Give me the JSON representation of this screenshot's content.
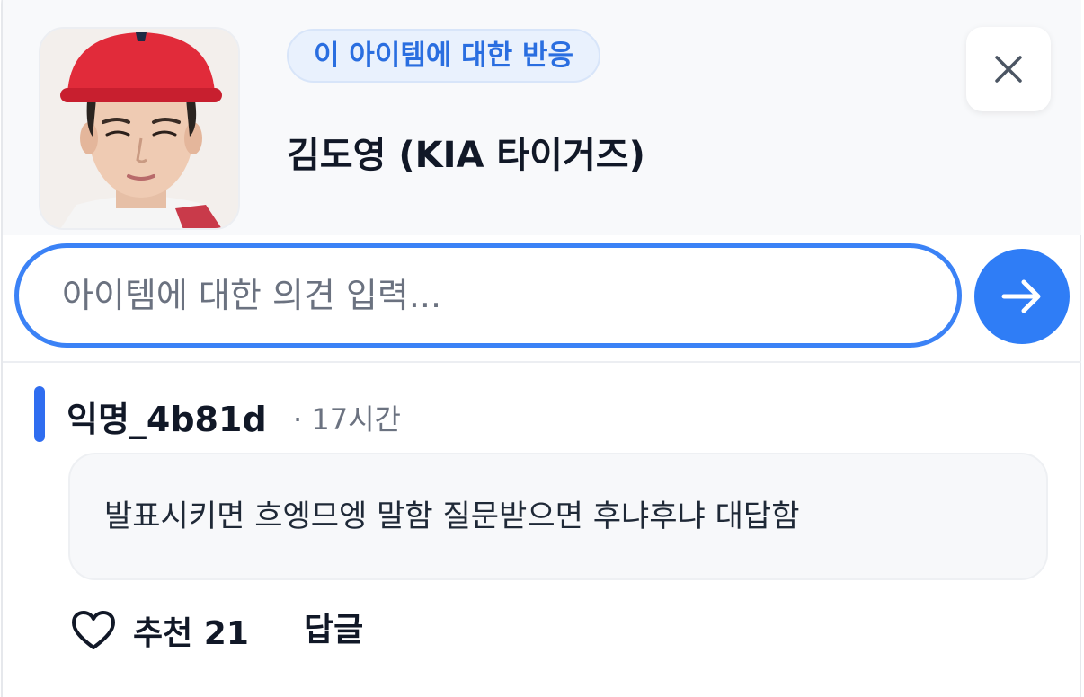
{
  "header": {
    "tag_label": "이 아이템에 대한 반응",
    "item_title": "김도영 (KIA 타이거즈)",
    "avatar_icon": "player-photo"
  },
  "close_icon": "close-icon",
  "comment_input": {
    "placeholder": "아이템에 대한 의견 입력...",
    "value": ""
  },
  "send_icon": "arrow-right-icon",
  "comments": [
    {
      "author": "익명_4b81d",
      "meta": "· 17시간",
      "text": "발표시키면 흐엥므엥 말함 질문받으면 후냐후냐 대답함",
      "like_label": "추천 21",
      "reply_label": "답글"
    }
  ],
  "colors": {
    "accent": "#2f7df6",
    "tag_text": "#2a6ee0",
    "tag_bg": "#e9f1fd",
    "header_bg": "#f8f9fb"
  }
}
